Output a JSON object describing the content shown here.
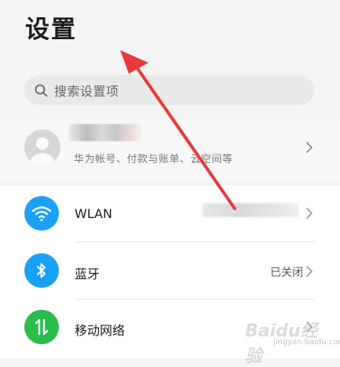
{
  "header": {
    "title": "设置"
  },
  "search": {
    "placeholder": "搜索设置项",
    "icon": "search-icon"
  },
  "account": {
    "subtitle": "华为帐号、付款与账单、云空间等",
    "avatar_icon": "user-avatar-icon"
  },
  "settings": {
    "items": [
      {
        "label": "WLAN",
        "value": "",
        "icon": "wifi-icon",
        "color": "#1aa1f5"
      },
      {
        "label": "蓝牙",
        "value": "已关闭",
        "icon": "bluetooth-icon",
        "color": "#1aa1f5"
      },
      {
        "label": "移动网络",
        "value": "",
        "icon": "mobile-data-icon",
        "color": "#2bbd4b"
      }
    ]
  },
  "watermark": {
    "brand": "Baidu经验",
    "url": "jingyan.baidu.com"
  },
  "colors": {
    "accent_blue": "#1aa1f5",
    "accent_green": "#2bbd4b",
    "arrow_red": "#e83a3a"
  }
}
